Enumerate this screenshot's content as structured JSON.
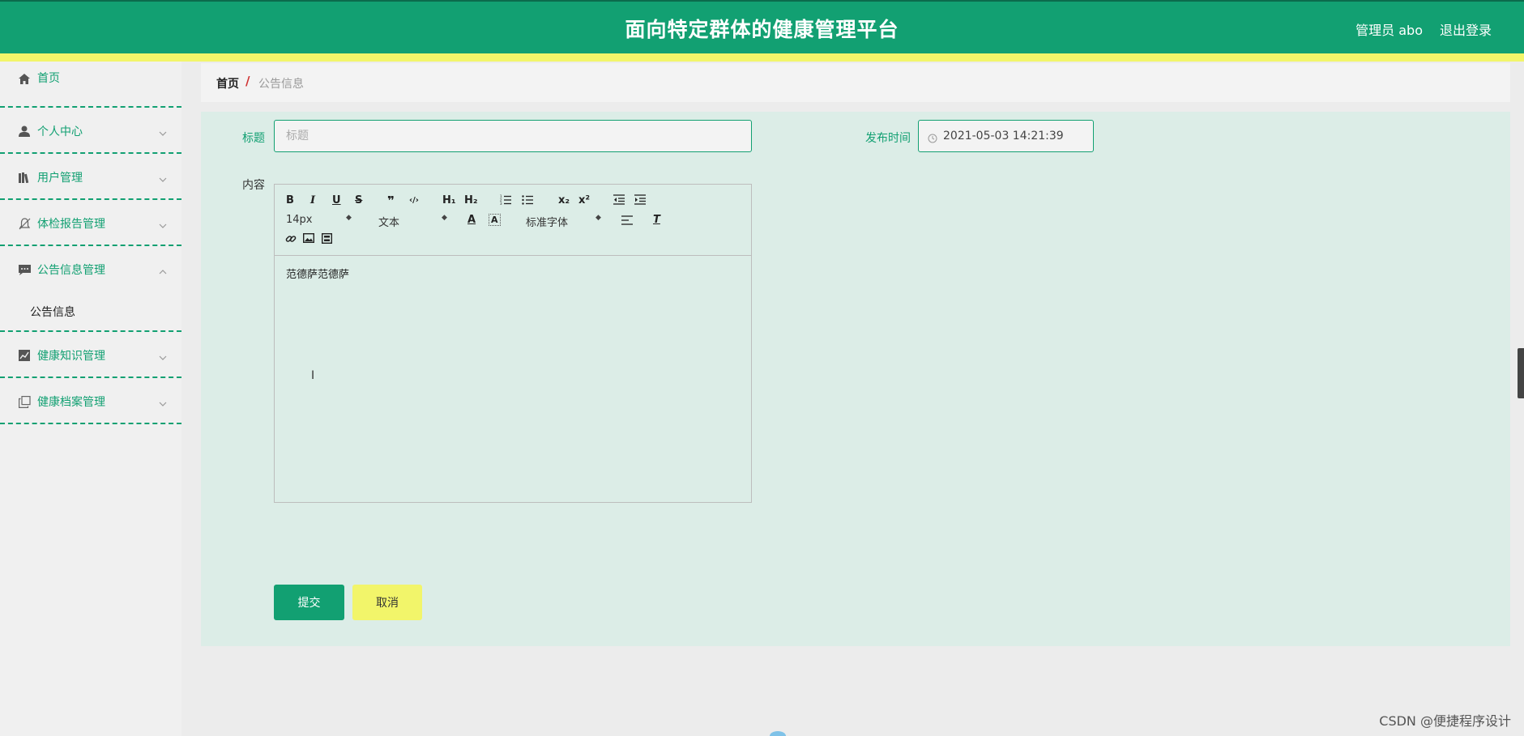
{
  "header": {
    "title": "面向特定群体的健康管理平台",
    "user": "管理员 abo",
    "logout": "退出登录"
  },
  "sidebar": {
    "items": [
      {
        "label": "首页",
        "icon": "home-icon"
      },
      {
        "label": "个人中心",
        "icon": "user-icon"
      },
      {
        "label": "用户管理",
        "icon": "books-icon"
      },
      {
        "label": "体检报告管理",
        "icon": "bell-off-icon"
      },
      {
        "label": "公告信息管理",
        "icon": "chat-icon",
        "sub": [
          "公告信息"
        ]
      },
      {
        "label": "健康知识管理",
        "icon": "chart-icon"
      },
      {
        "label": "健康档案管理",
        "icon": "copy-icon"
      }
    ]
  },
  "breadcrumb": {
    "home": "首页",
    "separator": "/",
    "current": "公告信息"
  },
  "form": {
    "title_label": "标题",
    "title_placeholder": "标题",
    "time_label": "发布时间",
    "time_value": "2021-05-03 14:21:39",
    "content_label": "内容",
    "content_text": "范德萨范德萨",
    "submit": "提交",
    "cancel": "取消"
  },
  "editor": {
    "toolbar": {
      "bold": "B",
      "italic": "I",
      "underline": "U",
      "strike": "S",
      "quote": "❞",
      "code": "‹/›",
      "h1": "H₁",
      "h2": "H₂",
      "sub": "x₂",
      "sup": "x²",
      "size": "14px",
      "header": "文本",
      "font": "标准字体",
      "color": "A",
      "background": "A",
      "clean": "T"
    }
  },
  "watermark": "CSDN @便捷程序设计",
  "colors": {
    "primary": "#12a072",
    "accent": "#f2f56a",
    "panel": "#dcede7"
  }
}
